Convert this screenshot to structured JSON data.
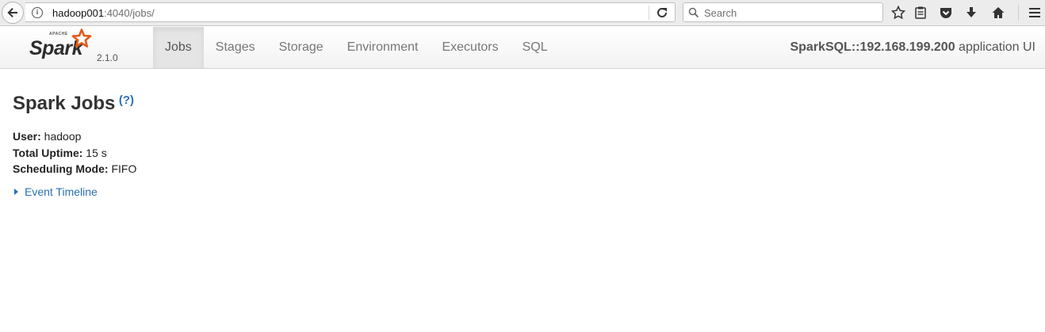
{
  "browser": {
    "url_host": "hadoop001",
    "url_rest": ":4040/jobs/",
    "search_placeholder": "Search",
    "icons": [
      "back-icon",
      "info-icon",
      "reload-icon",
      "search-icon",
      "bookmark-star-icon",
      "reading-list-icon",
      "pocket-icon",
      "download-icon",
      "home-icon",
      "menu-icon"
    ]
  },
  "navbar": {
    "brand_name": "Spark",
    "brand_apache": "APACHE",
    "version": "2.1.0",
    "tabs": [
      {
        "label": "Jobs",
        "active": true
      },
      {
        "label": "Stages",
        "active": false
      },
      {
        "label": "Storage",
        "active": false
      },
      {
        "label": "Environment",
        "active": false
      },
      {
        "label": "Executors",
        "active": false
      },
      {
        "label": "SQL",
        "active": false
      }
    ],
    "app_name": "SparkSQL::192.168.199.200",
    "app_suffix": " application UI",
    "accent_color": "#e25a1c"
  },
  "page": {
    "title": "Spark Jobs",
    "help": "(?)",
    "user_label": "User:",
    "user_value": " hadoop",
    "uptime_label": "Total Uptime:",
    "uptime_value": " 15 s",
    "mode_label": "Scheduling Mode:",
    "mode_value": " FIFO",
    "timeline_label": "Event Timeline",
    "link_color": "#2a6fb4"
  }
}
